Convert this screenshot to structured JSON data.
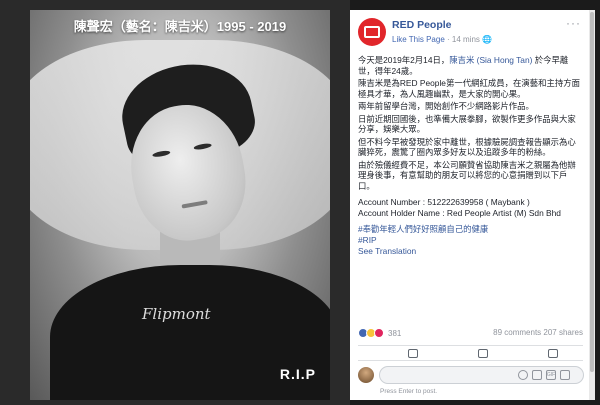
{
  "photo": {
    "title": "陳聲宏（藝名：陳吉米）1995 - 2019",
    "shirt_logo": "Flipmont",
    "rip": "R.I.P"
  },
  "post": {
    "page_name": "RED People",
    "like_this_page": "Like This Page",
    "separator": "·",
    "time": "14 mins",
    "privacy_icon": "globe-icon",
    "brand_color": "#e1262b",
    "p1_before": "今天是2019年2月14日，",
    "p1_link": "陳吉米 (Sia Hong Tan)",
    "p1_after": " 於今早離世，得年24歲。",
    "p2": "陳吉米是為RED People第一代網紅成員，在演藝和主持方面極具才華，為人風趣幽默，是大家的開心果。",
    "p3": "兩年前留學台灣，開始創作不少網路影片作品。",
    "p4": "日前近期回國後，也準備大展拳腳，欲製作更多作品與大家分享，娛樂大眾。",
    "p5": "但不料今早被發現於家中離世，根據驗屍調查報告顯示為心臟猝死，震驚了圈內眾多好友以及追蹤多年的粉絲。",
    "p6": "由於殮儀經費不足，本公司願贊省協助陳吉米之親屬為他辦理身後事，有意幫助的朋友可以將您的心意捐贈到以下戶口。",
    "account_number": "Account Number : 512222639958 ( Maybank )",
    "account_holder": "Account Holder Name : Red People Artist (M) Sdn Bhd",
    "hashtag1": "#奉勸年輕人們好好照顧自己的健康",
    "hashtag2": "#RIP",
    "see_translation": "See Translation",
    "reaction_count": "381",
    "comments": "89 comments",
    "shares": "207 shares",
    "comment_placeholder": "",
    "press_enter": "Press Enter to post."
  }
}
